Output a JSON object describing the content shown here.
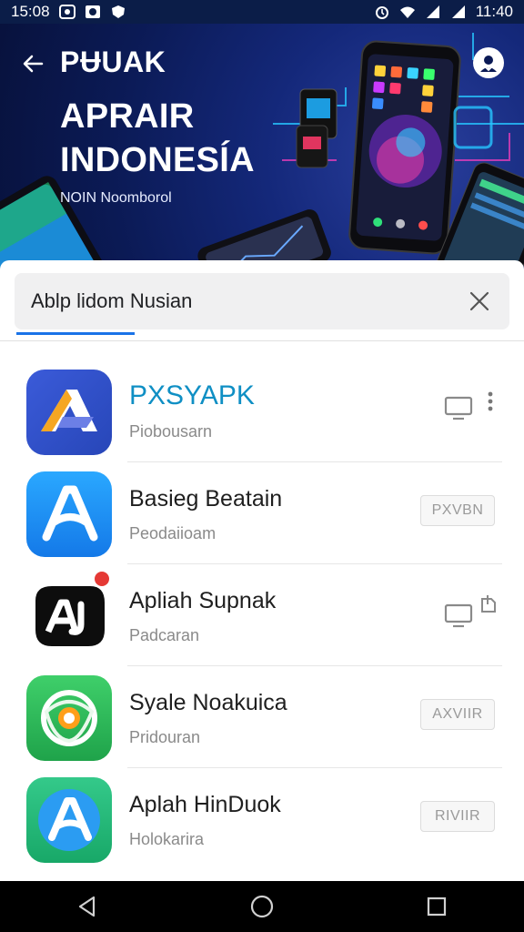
{
  "status_bar": {
    "time_left": "15:08",
    "time_right": "11:40"
  },
  "hero": {
    "brand": "PɄUAK",
    "title_line1": "APRAIR",
    "title_line2": "INDONESÍA",
    "subtitle": "NOIN Noomborol"
  },
  "search": {
    "value": "Ablp lidom Nusian"
  },
  "apps": [
    {
      "name": "PXSYAPK",
      "subtitle": "Piobousarn",
      "action": "",
      "icon": "monitor-icon"
    },
    {
      "name": "Basieg Beatain",
      "subtitle": "Peodaiioam",
      "action": "PXVBN",
      "icon": ""
    },
    {
      "name": "Apliah Supnak",
      "subtitle": "Padcaran",
      "action": "",
      "icon": "monitor-icon"
    },
    {
      "name": "Syale Noakuica",
      "subtitle": "Pridouran",
      "action": "AXVIIR",
      "icon": ""
    },
    {
      "name": "Aplah HinDuok",
      "subtitle": "Holokarira",
      "action": "RIVIIR",
      "icon": ""
    }
  ],
  "colors": {
    "accent": "#1a73e8",
    "hero_bg": "#0b1a55"
  }
}
